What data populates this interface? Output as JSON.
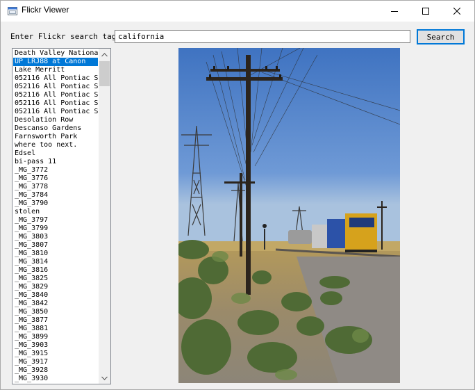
{
  "window": {
    "title": "Flickr Viewer"
  },
  "search": {
    "label": "Enter Flickr search tags",
    "value": "california",
    "button": "Search"
  },
  "results": {
    "selected_index": 1,
    "items": [
      "Death Valley Nationa",
      "UP LRJ88 at Canon",
      "Lake Merritt",
      "052116 All Pontiac S",
      "052116 All Pontiac S",
      "052116 All Pontiac S",
      "052116 All Pontiac S",
      "052116 All Pontiac S",
      "Desolation Row",
      "Descanso Gardens",
      "Farnsworth Park",
      "where too next.",
      "Edsel",
      "bi-pass 11",
      "_MG_3772",
      "_MG_3776",
      "_MG_3778",
      "_MG_3784",
      "_MG_3790",
      "stolen",
      "_MG_3797",
      "_MG_3799",
      "_MG_3803",
      "_MG_3807",
      "_MG_3810",
      "_MG_3814",
      "_MG_3816",
      "_MG_3825",
      "_MG_3829",
      "_MG_3840",
      "_MG_3842",
      "_MG_3850",
      "_MG_3877",
      "_MG_3881",
      "_MG_3899",
      "_MG_3903",
      "_MG_3915",
      "_MG_3917",
      "_MG_3928",
      "_MG_3930"
    ]
  },
  "icons": {
    "app": "flickr-app-icon",
    "minimize": "minimize-icon",
    "maximize": "maximize-icon",
    "close": "close-icon",
    "scroll_up": "chevron-up-icon",
    "scroll_down": "chevron-down-icon"
  },
  "colors": {
    "selection": "#0078d7",
    "button_border": "#0078d7",
    "sky": "#4a7fc8"
  }
}
